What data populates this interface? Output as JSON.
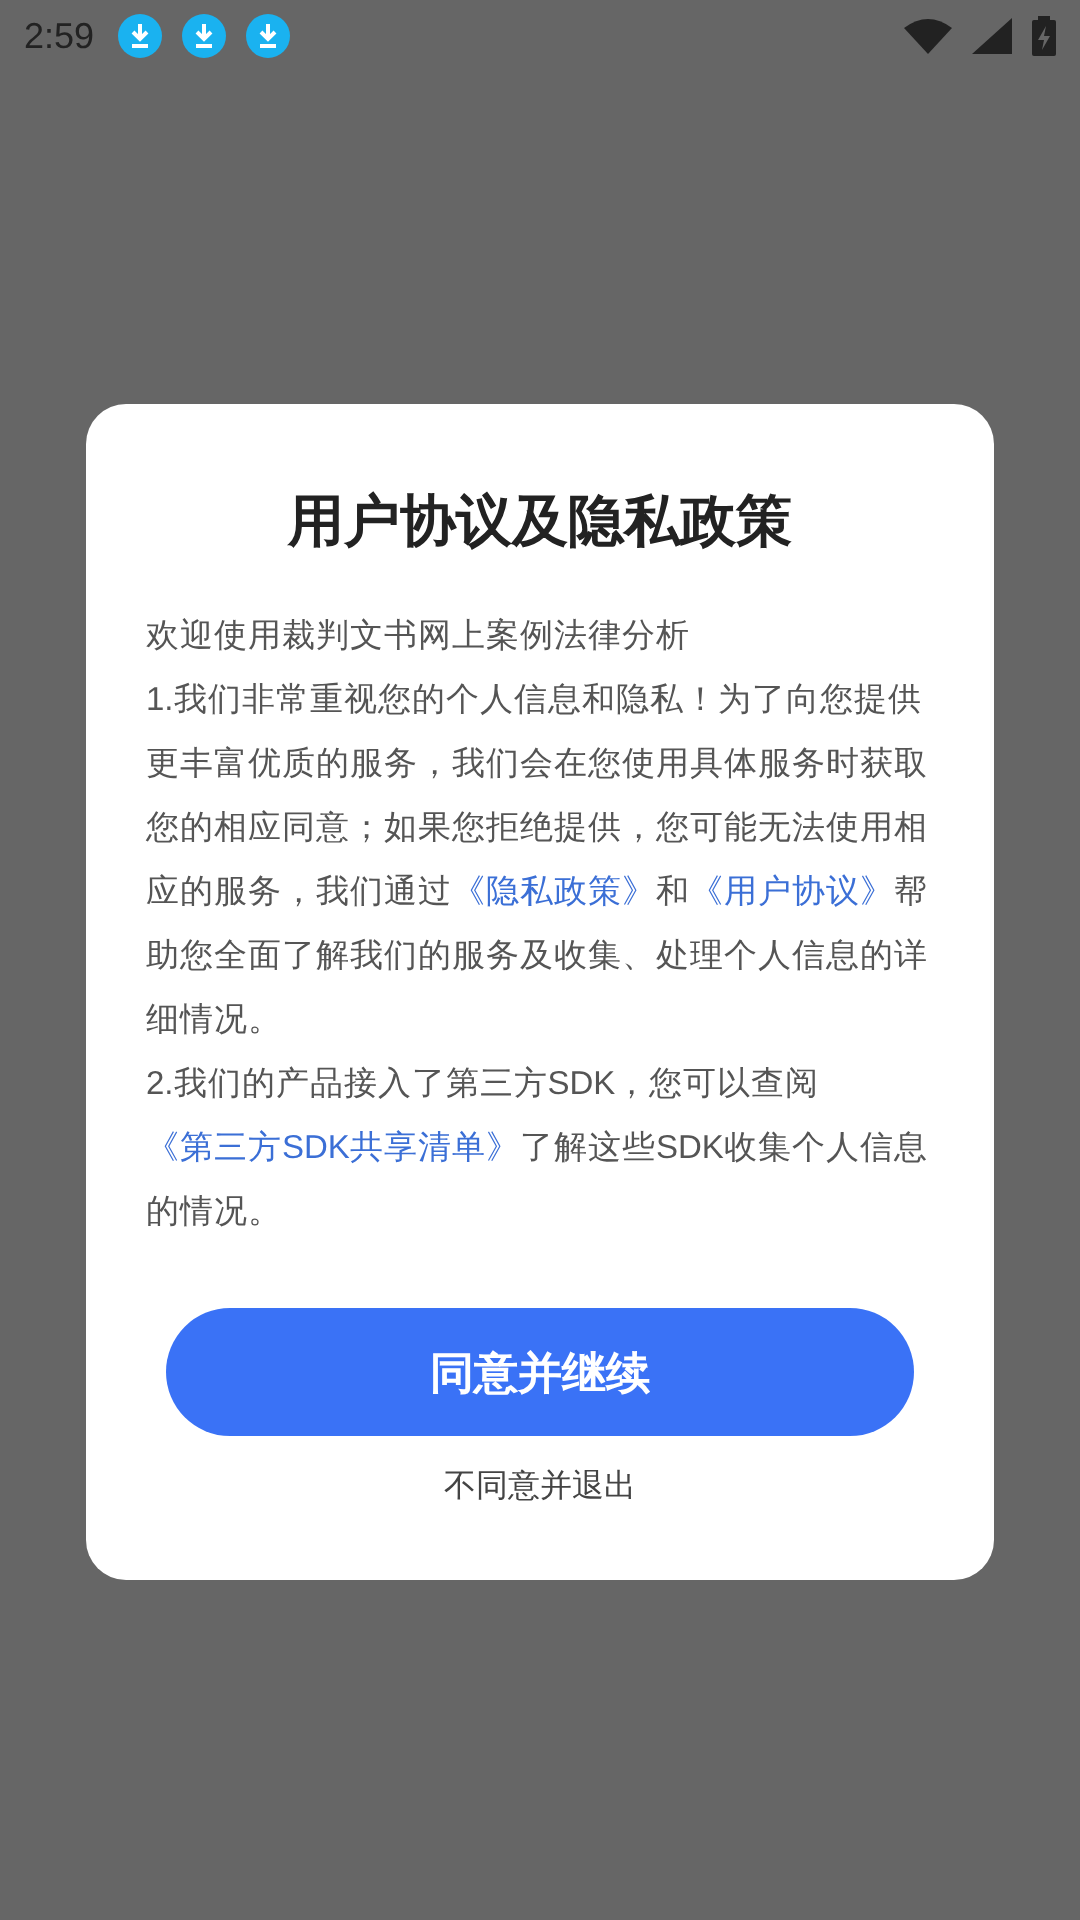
{
  "status_bar": {
    "time": "2:59",
    "notifications": [
      {
        "kind": "download"
      },
      {
        "kind": "download"
      },
      {
        "kind": "download"
      }
    ]
  },
  "dialog": {
    "title": "用户协议及隐私政策",
    "paragraphs": [
      [
        {
          "kind": "text",
          "text": "欢迎使用裁判文书网上案例法律分析"
        }
      ],
      [
        {
          "kind": "text",
          "text": "1.我们非常重视您的个人信息和隐私！为了向您提供更丰富优质的服务，我们会在您使用具体服务时获取您的相应同意；如果您拒绝提供，您可能无法使用相应的服务，我们通过"
        },
        {
          "kind": "link",
          "text": "《隐私政策》"
        },
        {
          "kind": "text",
          "text": "和"
        },
        {
          "kind": "link",
          "text": "《用户协议》"
        },
        {
          "kind": "text",
          "text": "帮助您全面了解我们的服务及收集、处理个人信息的详细情况。"
        }
      ],
      [
        {
          "kind": "text",
          "text": "2.我们的产品接入了第三方SDK，您可以查阅"
        },
        {
          "kind": "link",
          "text": "《第三方SDK共享清单》"
        },
        {
          "kind": "text",
          "text": "了解这些SDK收集个人信息的情况。"
        }
      ]
    ],
    "agree_button": "同意并继续",
    "decline_link": "不同意并退出"
  }
}
